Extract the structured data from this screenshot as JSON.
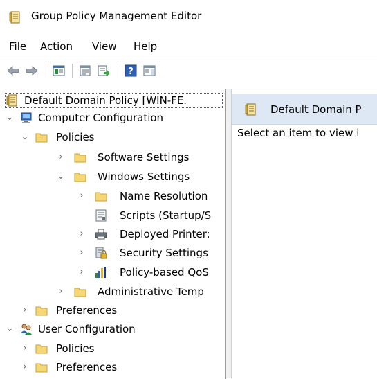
{
  "window": {
    "title": "Group Policy Management Editor"
  },
  "menu": {
    "file": "File",
    "action": "Action",
    "view": "View",
    "help": "Help"
  },
  "tree": {
    "root": "Default Domain Policy [WIN-FE.",
    "computer_configuration": "Computer Configuration",
    "cc_policies": "Policies",
    "software_settings": "Software Settings",
    "windows_settings": "Windows Settings",
    "name_resolution": "Name Resolution",
    "scripts": "Scripts (Startup/S",
    "deployed_printers": "Deployed Printer:",
    "security_settings": "Security Settings",
    "policy_qos": "Policy-based QoS",
    "admin_templates": "Administrative Temp",
    "cc_preferences": "Preferences",
    "user_configuration": "User Configuration",
    "uc_policies": "Policies",
    "uc_preferences": "Preferences"
  },
  "right_pane": {
    "header": "Default Domain P",
    "message": "Select an item to view i"
  }
}
